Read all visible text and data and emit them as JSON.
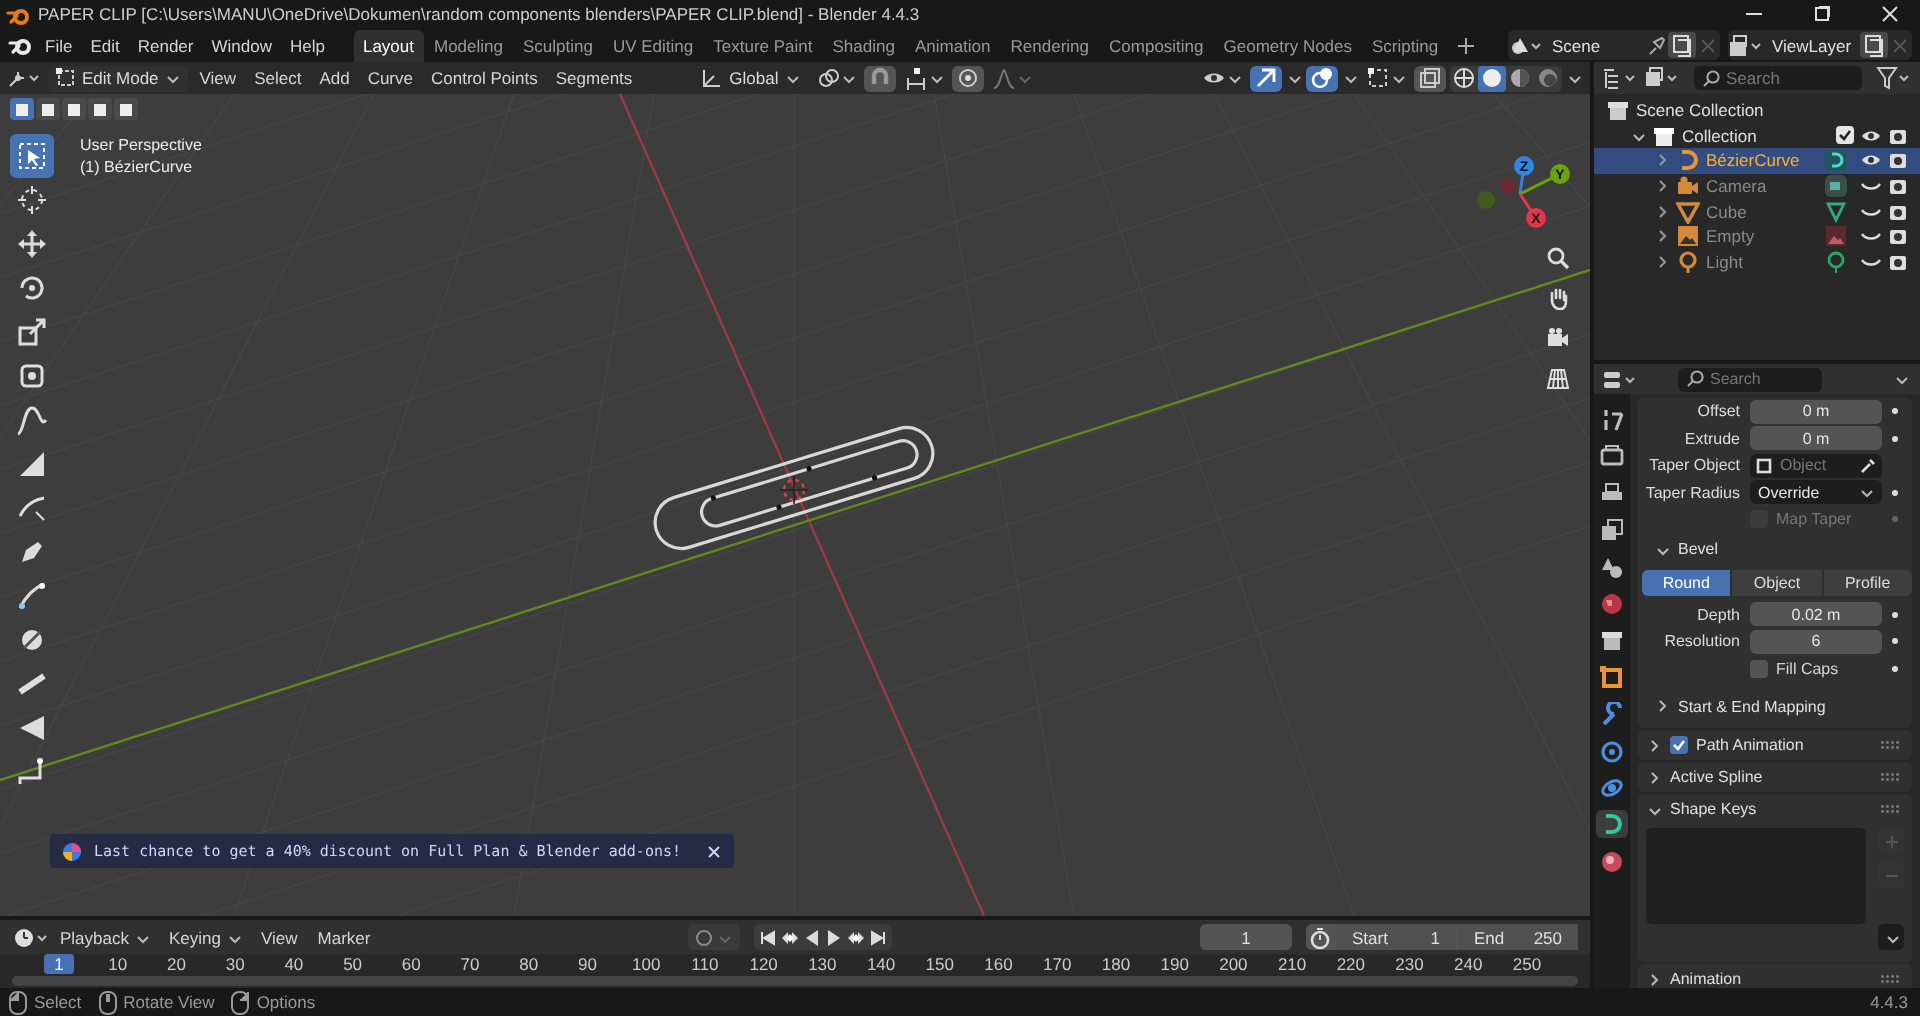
{
  "window": {
    "title": "PAPER CLIP [C:\\Users\\MANU\\OneDrive\\Dokumen\\random components blenders\\PAPER CLIP.blend] - Blender 4.4.3"
  },
  "menu": [
    "File",
    "Edit",
    "Render",
    "Window",
    "Help"
  ],
  "workspaces": [
    {
      "label": "Layout",
      "selected": true
    },
    {
      "label": "Modeling",
      "selected": false
    },
    {
      "label": "Sculpting",
      "selected": false
    },
    {
      "label": "UV Editing",
      "selected": false
    },
    {
      "label": "Texture Paint",
      "selected": false
    },
    {
      "label": "Shading",
      "selected": false
    },
    {
      "label": "Animation",
      "selected": false
    },
    {
      "label": "Rendering",
      "selected": false
    },
    {
      "label": "Compositing",
      "selected": false
    },
    {
      "label": "Geometry Nodes",
      "selected": false
    },
    {
      "label": "Scripting",
      "selected": false
    }
  ],
  "scene": {
    "value": "Scene"
  },
  "view_layer": {
    "value": "ViewLayer"
  },
  "viewport": {
    "mode": "Edit Mode",
    "menus": [
      "View",
      "Select",
      "Add",
      "Curve",
      "Control Points",
      "Segments"
    ],
    "orientation": "Global",
    "select_modes": [
      {
        "selected": true
      },
      {
        "selected": false
      },
      {
        "selected": false
      },
      {
        "selected": false
      },
      {
        "selected": false
      }
    ],
    "shading": [
      {
        "kind": "wireframe",
        "selected": false
      },
      {
        "kind": "solid",
        "selected": true
      },
      {
        "kind": "material",
        "selected": false
      },
      {
        "kind": "rendered",
        "selected": false
      }
    ],
    "info": [
      "User Perspective",
      "(1) BézierCurve"
    ],
    "tools": [
      {
        "kind": "select",
        "selected": true
      },
      {
        "kind": "cursor",
        "selected": false
      },
      {
        "kind": "move",
        "selected": false
      },
      {
        "kind": "rotate",
        "selected": false
      },
      {
        "kind": "scale",
        "selected": false
      },
      {
        "kind": "transform",
        "selected": false
      },
      {
        "kind": "annotate",
        "selected": false
      },
      {
        "kind": "measure",
        "selected": false
      },
      {
        "kind": "draw",
        "selected": false
      },
      {
        "kind": "pen",
        "selected": false
      },
      {
        "kind": "extrude",
        "selected": false
      },
      {
        "kind": "radius",
        "selected": false
      },
      {
        "kind": "tilt",
        "selected": false
      },
      {
        "kind": "randomize",
        "selected": false
      },
      {
        "kind": "curve_pen",
        "selected": false
      }
    ],
    "gizmo_axes": [
      {
        "label": "Z",
        "color": "#2f85e3"
      },
      {
        "label": "Y",
        "color": "#6ba30f"
      },
      {
        "label": "X",
        "color": "#e3364b"
      }
    ],
    "banner": {
      "text": "Last chance to get a 40% discount on Full Plan & Blender add-ons!"
    }
  },
  "timeline": {
    "menus": [
      "Playback",
      "Keying",
      "View",
      "Marker"
    ],
    "current_frame": "1",
    "start": {
      "label": "Start",
      "value": "1"
    },
    "end": {
      "label": "End",
      "value": "250"
    },
    "ruler": [
      {
        "label": "1",
        "selected": true
      },
      {
        "label": "10",
        "selected": false
      },
      {
        "label": "20",
        "selected": false
      },
      {
        "label": "30",
        "selected": false
      },
      {
        "label": "40",
        "selected": false
      },
      {
        "label": "50",
        "selected": false
      },
      {
        "label": "60",
        "selected": false
      },
      {
        "label": "70",
        "selected": false
      },
      {
        "label": "80",
        "selected": false
      },
      {
        "label": "90",
        "selected": false
      },
      {
        "label": "100",
        "selected": false
      },
      {
        "label": "110",
        "selected": false
      },
      {
        "label": "120",
        "selected": false
      },
      {
        "label": "130",
        "selected": false
      },
      {
        "label": "140",
        "selected": false
      },
      {
        "label": "150",
        "selected": false
      },
      {
        "label": "160",
        "selected": false
      },
      {
        "label": "170",
        "selected": false
      },
      {
        "label": "180",
        "selected": false
      },
      {
        "label": "190",
        "selected": false
      },
      {
        "label": "200",
        "selected": false
      },
      {
        "label": "210",
        "selected": false
      },
      {
        "label": "220",
        "selected": false
      },
      {
        "label": "230",
        "selected": false
      },
      {
        "label": "240",
        "selected": false
      },
      {
        "label": "250",
        "selected": false
      }
    ]
  },
  "outliner": {
    "search": {
      "placeholder": "Search"
    },
    "tree": [
      {
        "label": "Scene Collection",
        "kind": "scene_collection",
        "children": [
          {
            "label": "Collection",
            "kind": "collection",
            "expanded": true,
            "checked": true,
            "visible": true,
            "children": [
              {
                "label": "BézierCurve",
                "kind": "curve",
                "expanded": false,
                "selected": true,
                "visible": true
              },
              {
                "label": "Camera",
                "kind": "camera",
                "expanded": false,
                "selected": false,
                "visible": false
              },
              {
                "label": "Cube",
                "kind": "mesh",
                "expanded": false,
                "selected": false,
                "visible": false
              },
              {
                "label": "Empty",
                "kind": "empty",
                "expanded": false,
                "selected": false,
                "visible": false
              },
              {
                "label": "Light",
                "kind": "light",
                "expanded": false,
                "selected": false,
                "visible": false
              }
            ]
          }
        ]
      }
    ]
  },
  "properties": {
    "search": {
      "placeholder": "Search"
    },
    "tabs": [
      {
        "kind": "tool",
        "selected": false
      },
      {
        "kind": "render",
        "selected": false
      },
      {
        "kind": "output",
        "selected": false
      },
      {
        "kind": "view_layer",
        "selected": false
      },
      {
        "kind": "scene",
        "selected": false
      },
      {
        "kind": "world",
        "selected": false
      },
      {
        "kind": "collection",
        "selected": false
      },
      {
        "kind": "object",
        "selected": false
      },
      {
        "kind": "modifiers",
        "selected": false
      },
      {
        "kind": "particles",
        "selected": false
      },
      {
        "kind": "physics",
        "selected": false
      },
      {
        "kind": "data",
        "selected": true
      },
      {
        "kind": "material",
        "selected": false
      }
    ],
    "fields": [
      {
        "kind": "number",
        "label": "Offset",
        "value": "0 m"
      },
      {
        "kind": "number",
        "label": "Extrude",
        "value": "0 m"
      },
      {
        "kind": "object",
        "label": "Taper Object",
        "placeholder": "Object"
      },
      {
        "kind": "dropdown",
        "label": "Taper Radius",
        "value": "Override"
      },
      {
        "kind": "checkbox",
        "label": "Map Taper",
        "checked": false,
        "disabled": true
      }
    ],
    "bevel": {
      "label": "Bevel",
      "expanded": true,
      "modes": [
        {
          "label": "Round",
          "selected": true
        },
        {
          "label": "Object",
          "selected": false
        },
        {
          "label": "Profile",
          "selected": false
        }
      ],
      "fields": [
        {
          "kind": "number",
          "label": "Depth",
          "value": "0.02 m"
        },
        {
          "kind": "number",
          "label": "Resolution",
          "value": "6"
        },
        {
          "kind": "checkbox",
          "label": "Fill Caps",
          "checked": false,
          "disabled": false
        }
      ]
    },
    "subpanel": {
      "label": "Start & End Mapping",
      "expanded": false
    },
    "panels": [
      {
        "kind": "toggle",
        "label": "Path Animation",
        "expanded": false,
        "checked": true
      },
      {
        "kind": "plain",
        "label": "Active Spline",
        "expanded": false
      },
      {
        "kind": "list",
        "label": "Shape Keys",
        "expanded": true
      },
      {
        "kind": "plain",
        "label": "Animation",
        "expanded": false
      }
    ]
  },
  "status": {
    "items": [
      {
        "kind": "left_mouse",
        "label": "Select"
      },
      {
        "kind": "middle_mouse",
        "label": "Rotate View"
      },
      {
        "kind": "right_mouse",
        "label": "Options"
      }
    ],
    "version": "4.4.3"
  }
}
